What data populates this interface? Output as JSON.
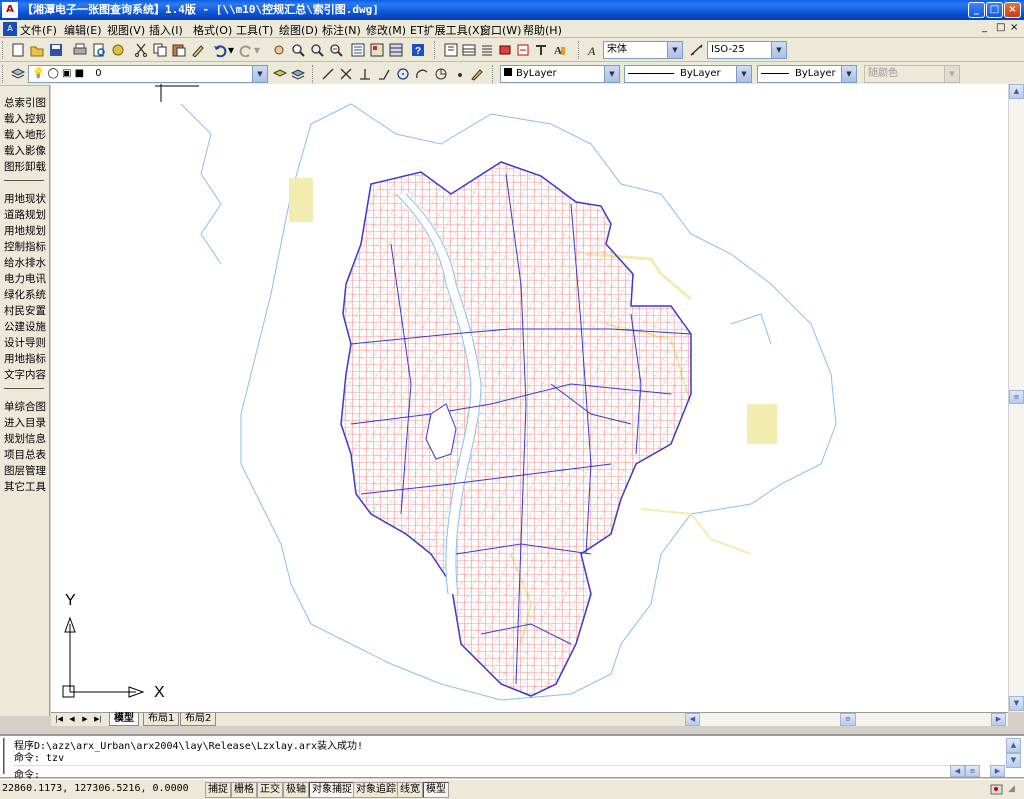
{
  "window": {
    "title": "【湘潭电子一张图查询系统】1.4版 - [\\\\m10\\控规汇总\\索引图.dwg]",
    "minimize": "_",
    "maximize": "□",
    "close": "×"
  },
  "menubar": {
    "items": [
      "文件(F)",
      "编辑(E)",
      "视图(V)",
      "插入(I)",
      "格式(O)",
      "工具(T)",
      "绘图(D)",
      "标注(N)",
      "修改(M)",
      "ET扩展工具(X)",
      "窗口(W)",
      "帮助(H)"
    ],
    "mdi_controls": [
      "_",
      "□",
      "×"
    ]
  },
  "toolbar": {
    "text_style": "宋体",
    "dim_style": "ISO-25",
    "layer": "0",
    "color": "ByLayer",
    "linetype": "ByLayer",
    "lineweight": "ByLayer",
    "plot_style": "随颜色"
  },
  "sidebar": {
    "group1": [
      "总索引图",
      "载入控规",
      "载入地形",
      "载入影像",
      "图形卸载"
    ],
    "group2": [
      "用地现状",
      "道路规划",
      "用地规划",
      "控制指标",
      "给水排水",
      "电力电讯",
      "绿化系统",
      "村民安置",
      "公建设施",
      "设计导则",
      "用地指标",
      "文字内容"
    ],
    "group3": [
      "单综合图",
      "进入目录",
      "规划信息",
      "项目总表",
      "图层管理",
      "其它工具"
    ]
  },
  "canvas": {
    "ucs_x": "X",
    "ucs_y": "Y",
    "colors": {
      "boundary": "#3a3acc",
      "roads": "#e04848",
      "water": "#88bff0",
      "green": "#f3ecb0"
    }
  },
  "tabs": [
    "模型",
    "布局1",
    "布局2"
  ],
  "command": {
    "line1": "程序D:\\azz\\arx_Urban\\arx2004\\lay\\Release\\Lzxlay.arx装入成功!",
    "line2": "命令: tzv",
    "prompt": "命令:"
  },
  "status": {
    "coords": "22860.1173, 127306.5216, 0.0000",
    "toggles": [
      "捕捉",
      "栅格",
      "正交",
      "极轴",
      "对象捕捉",
      "对象追踪",
      "线宽",
      "模型"
    ]
  }
}
